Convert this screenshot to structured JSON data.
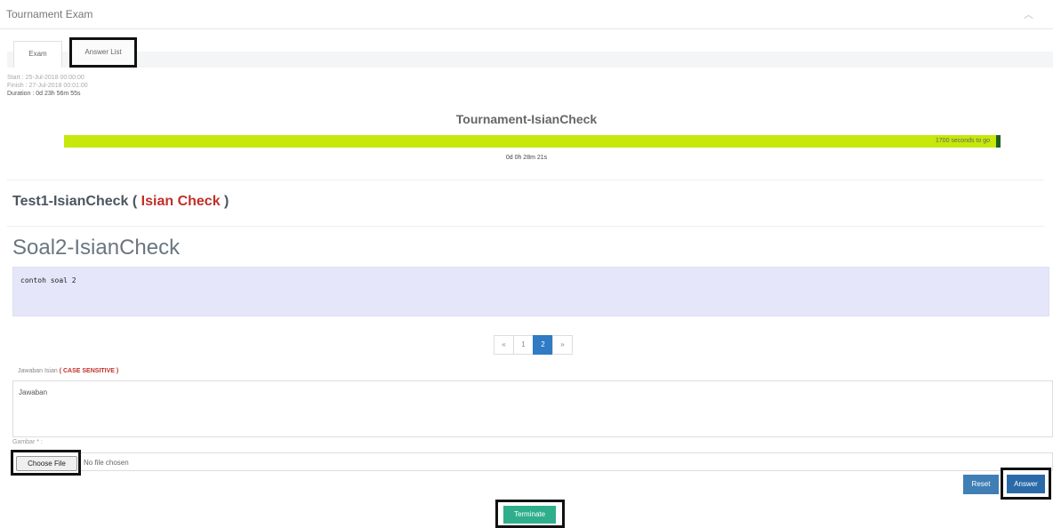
{
  "panel": {
    "title": "Tournament Exam",
    "collapse_icon": "chevron-up-icon"
  },
  "tabs": [
    {
      "label": "Exam",
      "active": true
    },
    {
      "label": "Answer List",
      "active": false
    }
  ],
  "exam_info": {
    "start": "Start : 25-Jul-2018 00:00:00",
    "finish": "Finish : 27-Jul-2018 00:01:00",
    "duration": "Duration : 0d 23h 56m 55s"
  },
  "exam_title": "Tournament-IsianCheck",
  "progress": {
    "fraction_remaining": 1.0,
    "text": "1700 seconds to go",
    "elapsed": "0d 0h 28m 21s",
    "fill_color": "#c6e80a"
  },
  "test": {
    "name": "Test1-IsianCheck",
    "open": "(",
    "type": "Isian Check",
    "close": ")"
  },
  "question": {
    "title": "Soal2-IsianCheck",
    "body": "contoh soal 2"
  },
  "pagination": {
    "prev": "«",
    "pages": [
      "1",
      "2"
    ],
    "current": "2",
    "next": "»"
  },
  "answer": {
    "label": "Jawaban Isian",
    "note": "( CASE SENSITIVE )",
    "value": "Jawaban"
  },
  "image_field": {
    "label": "Gambar * :",
    "choose_label": "Choose File",
    "no_file_text": "No file chosen"
  },
  "buttons": {
    "reset": "Reset",
    "answer": "Answer",
    "terminate": "Terminate"
  },
  "colors": {
    "primary": "#2f7bc4",
    "success": "#2fae8c",
    "danger": "#c0302a"
  }
}
